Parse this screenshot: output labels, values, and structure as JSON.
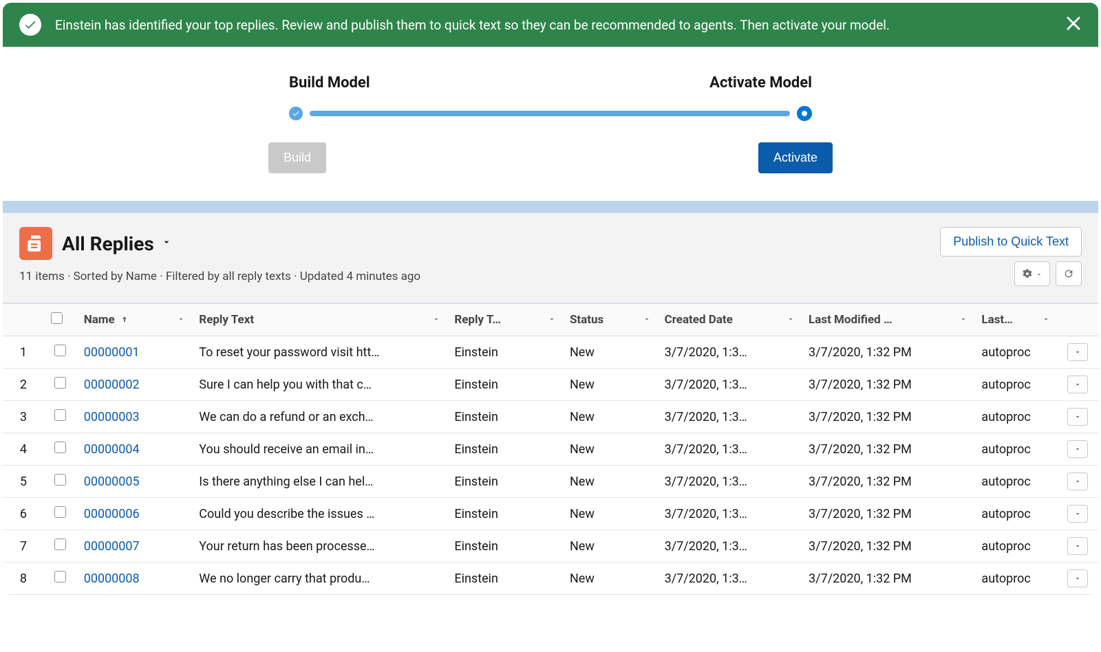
{
  "banner": {
    "message": "Einstein has identified your top replies. Review and publish them to quick text so they can be recommended to agents. Then activate your model."
  },
  "progress": {
    "left_label": "Build Model",
    "right_label": "Activate Model",
    "build_button": "Build",
    "activate_button": "Activate"
  },
  "list": {
    "title": "All Replies",
    "publish_button": "Publish to Quick Text",
    "meta": "11 items · Sorted by Name · Filtered by all reply texts · Updated 4 minutes ago",
    "columns": {
      "name": "Name",
      "reply_text": "Reply Text",
      "reply_type": "Reply T…",
      "status": "Status",
      "created": "Created Date",
      "modified": "Last Modified …",
      "last": "Last…"
    },
    "rows": [
      {
        "num": "1",
        "name": "00000001",
        "reply": "To reset your password visit htt…",
        "rtype": "Einstein",
        "status": "New",
        "created": "3/7/2020, 1:3…",
        "modified": "3/7/2020, 1:32 PM",
        "last": "autoproc"
      },
      {
        "num": "2",
        "name": "00000002",
        "reply": "Sure I can help you with that c…",
        "rtype": "Einstein",
        "status": "New",
        "created": "3/7/2020, 1:3…",
        "modified": "3/7/2020, 1:32 PM",
        "last": "autoproc"
      },
      {
        "num": "3",
        "name": "00000003",
        "reply": "We can do a refund or an exch…",
        "rtype": "Einstein",
        "status": "New",
        "created": "3/7/2020, 1:3…",
        "modified": "3/7/2020, 1:32 PM",
        "last": "autoproc"
      },
      {
        "num": "4",
        "name": "00000004",
        "reply": "You should receive an email in…",
        "rtype": "Einstein",
        "status": "New",
        "created": "3/7/2020, 1:3…",
        "modified": "3/7/2020, 1:32 PM",
        "last": "autoproc"
      },
      {
        "num": "5",
        "name": "00000005",
        "reply": "Is there anything else I can hel…",
        "rtype": "Einstein",
        "status": "New",
        "created": "3/7/2020, 1:3…",
        "modified": "3/7/2020, 1:32 PM",
        "last": "autoproc"
      },
      {
        "num": "6",
        "name": "00000006",
        "reply": "Could you describe the issues …",
        "rtype": "Einstein",
        "status": "New",
        "created": "3/7/2020, 1:3…",
        "modified": "3/7/2020, 1:32 PM",
        "last": "autoproc"
      },
      {
        "num": "7",
        "name": "00000007",
        "reply": "Your return has been processe…",
        "rtype": "Einstein",
        "status": "New",
        "created": "3/7/2020, 1:3…",
        "modified": "3/7/2020, 1:32 PM",
        "last": "autoproc"
      },
      {
        "num": "8",
        "name": "00000008",
        "reply": "We no longer carry that produ…",
        "rtype": "Einstein",
        "status": "New",
        "created": "3/7/2020, 1:3…",
        "modified": "3/7/2020, 1:32 PM",
        "last": "autoproc"
      }
    ]
  }
}
